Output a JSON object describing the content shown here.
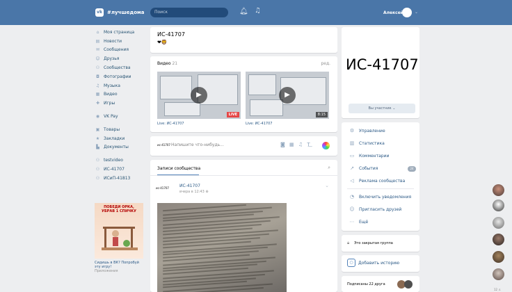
{
  "header": {
    "logo_text": "#лучшедома",
    "logo_mark": "vk",
    "search_placeholder": "Поиск",
    "username": "Алексей",
    "accent": "#4a76a8"
  },
  "left_nav": {
    "items": [
      {
        "label": "Моя страница",
        "icon": "home-icon",
        "glyph": "⌂"
      },
      {
        "label": "Новости",
        "icon": "news-icon",
        "glyph": "▤"
      },
      {
        "label": "Сообщения",
        "icon": "messages-icon",
        "glyph": "✉"
      },
      {
        "label": "Друзья",
        "icon": "friends-icon",
        "glyph": "☺"
      },
      {
        "label": "Сообщества",
        "icon": "groups-icon",
        "glyph": "⚇"
      },
      {
        "label": "Фотографии",
        "icon": "photos-icon",
        "glyph": "◘"
      },
      {
        "label": "Музыка",
        "icon": "music-icon",
        "glyph": "♫"
      },
      {
        "label": "Видео",
        "icon": "video-icon",
        "glyph": "▦"
      },
      {
        "label": "Игры",
        "icon": "games-icon",
        "glyph": "✚"
      }
    ],
    "items2": [
      {
        "label": "VK Pay",
        "icon": "vkpay-icon",
        "glyph": "◉"
      }
    ],
    "items3": [
      {
        "label": "Товары",
        "icon": "goods-icon",
        "glyph": "▣"
      },
      {
        "label": "Закладки",
        "icon": "bookmarks-icon",
        "glyph": "★"
      },
      {
        "label": "Документы",
        "icon": "documents-icon",
        "glyph": "▙"
      }
    ],
    "items4": [
      {
        "label": "testvideo",
        "icon": "group-icon",
        "glyph": "⚇"
      },
      {
        "label": "ИС-41707",
        "icon": "group-icon",
        "glyph": "⚇"
      },
      {
        "label": "ИСиП-41813",
        "icon": "group-icon",
        "glyph": "⚇"
      }
    ]
  },
  "ad": {
    "image_title": "ПОБЕДИ ОРКА, УБРАВ 1 СПИЧКУ",
    "caption": "Сидишь в ВК? Попробуй эту игру!",
    "sub": "Приложения"
  },
  "group": {
    "name": "ИС-41707",
    "emoji": "❤🦁"
  },
  "videos": {
    "title": "Видео",
    "count": "21",
    "edit": "ред.",
    "items": [
      {
        "caption": "Live: ИС-41707",
        "badge": "LIVE"
      },
      {
        "caption": "Live: ИС-41707",
        "badge": "8:15"
      }
    ]
  },
  "compose": {
    "logo": "ис-41707",
    "placeholder": "Напишите что-нибудь..."
  },
  "posts": {
    "tab": "Записи сообщества",
    "logo": "ис-41707",
    "author": "ИС-41707",
    "time": "вчера в 12:43 ⊕"
  },
  "cover": {
    "title": "ИС-41707",
    "member_button": "Вы участник ⌄"
  },
  "menu": {
    "items": [
      {
        "label": "Управление",
        "icon": "gear-icon",
        "glyph": "⚙"
      },
      {
        "label": "Статистика",
        "icon": "stats-icon",
        "glyph": "▥"
      },
      {
        "label": "Комментарии",
        "icon": "comments-icon",
        "glyph": "▭"
      },
      {
        "label": "События",
        "icon": "events-icon",
        "glyph": "↗"
      },
      {
        "label": "Реклама сообщества",
        "icon": "megaphone-icon",
        "glyph": "◁"
      },
      {
        "label": "Включить уведомления",
        "icon": "bell-icon",
        "glyph": "◔"
      },
      {
        "label": "Пригласить друзей",
        "icon": "invite-icon",
        "glyph": "☺"
      },
      {
        "label": "Ещё",
        "icon": "more-icon",
        "glyph": "⋯"
      }
    ],
    "events_badge": "24"
  },
  "closed": {
    "text": "Это закрытая группа"
  },
  "story": {
    "text": "Добавить историю"
  },
  "subscribers": {
    "text": "Подписаны 22 друга"
  },
  "favorites": {
    "count": "12"
  }
}
